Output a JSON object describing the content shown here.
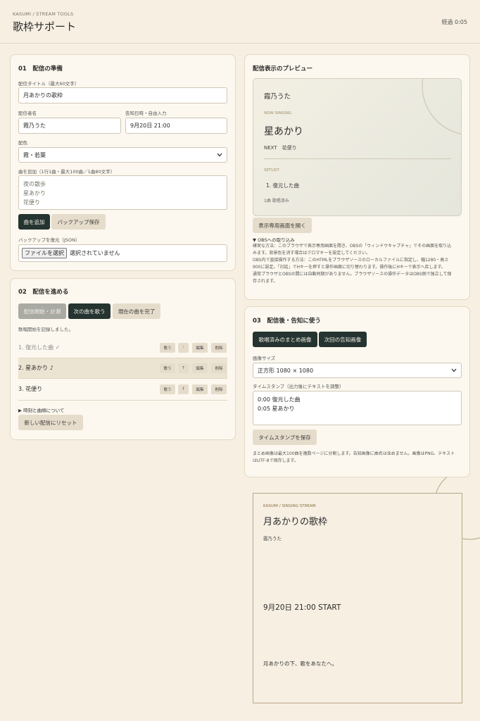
{
  "header": {
    "brand": "KASUMI / STREAM TOOLS",
    "title": "歌枠サポート",
    "elapsed": "経過 0:05"
  },
  "prep": {
    "heading": "01　配信の準備",
    "title_label": "配信タイトル（最大60文字）",
    "title_value": "月あかりの歌枠",
    "streamer_label": "配信者名",
    "streamer_value": "霞乃うた",
    "date_label": "告知日時・自由入力",
    "date_value": "9月20日 21:00",
    "color_label": "配色",
    "color_value": "霞・若葉",
    "songs_label": "曲を追加（1行1曲・最大100曲／1曲80文字）",
    "songs_placeholder": [
      "夜の散歩",
      "星あかり",
      "花便り"
    ],
    "add_button": "曲を追加",
    "backup_button": "バックアップ保存",
    "restore_label": "バックアップを復元（JSON）",
    "file_button": "ファイルを選択",
    "file_status": "選択されていません"
  },
  "progress": {
    "heading": "02　配信を進める",
    "start_button": "配信開始・計測",
    "next_button": "次の曲を歌う",
    "complete_button": "現在の曲を完了",
    "status": "歌唱開始を記録しました。",
    "songs": [
      {
        "name": "1. 復元した曲 ✓"
      },
      {
        "name": "2. 星あかり ♪"
      },
      {
        "name": "3. 花便り"
      }
    ],
    "row_actions": [
      "歌う",
      "↑",
      "編集",
      "削除"
    ],
    "about": "▶ 時刻と曲順について",
    "reset_button": "新しい配信にリセット"
  },
  "preview": {
    "heading": "配信表示のプレビュー",
    "streamer": "霞乃うた",
    "now_label": "NOW SINGING",
    "now_song": "星あかり",
    "next": "NEXT　花便り",
    "setlist_label": "SETLIST",
    "setlist_item": "1. 復元した曲",
    "sung_count": "1曲 歌唱済み",
    "open_button": "表示専用画面を開く",
    "obs_heading": "▼ OBSへの取り込み",
    "obs_lines": [
      "確実な方法：このブラウザで表示専用画面を開き、OBSの「ウィンドウキャプチャ」でその画面を取り込",
      "みます。背景色を消す場合はクロマキーを設定してください。",
      "OBS内で直接操作する方法：このHTMLをブラウザソースのローカルファイルに指定し、幅1280・高さ",
      "900に設定。「対話」でHキーを押すと操作画面に切り替わります。操作後にHキーで表示へ戻します。",
      "通常ブラウザとOBSの間には自動同期がありません。ブラウザソースの操作データはOBS側で独立して保",
      "存されます。"
    ]
  },
  "after": {
    "heading": "03　配信後・告知に使う",
    "summary_button": "歌唱済みのまとめ画像",
    "next_button": "次回の告知画像",
    "size_label": "画像サイズ",
    "size_value": "正方形 1080 × 1080",
    "timestamp_label": "タイムスタンプ（出力後にテキストを調整）",
    "timestamp_lines": [
      "0:00 復元した曲",
      "0:05 星あかり"
    ],
    "save_button": "タイムスタンプを保存",
    "note_lines": [
      "まとめ画像は最大100曲を複数ページに分割します。告知画像に曲名は含めません。画像はPNG、テキスト",
      "はUTF-8で保存します。"
    ]
  },
  "poster": {
    "brand": "KASUMI / SINGING STREAM",
    "title": "月あかりの歌枠",
    "streamer": "霞乃うた",
    "date": "9月20日 21:00 START",
    "message": "月あかりの下、歌をあなたへ。"
  },
  "colors": {
    "dark": "#253430",
    "light_button": "#e6dccb",
    "background": "#f6efe2",
    "card": "#fcf8ef"
  }
}
